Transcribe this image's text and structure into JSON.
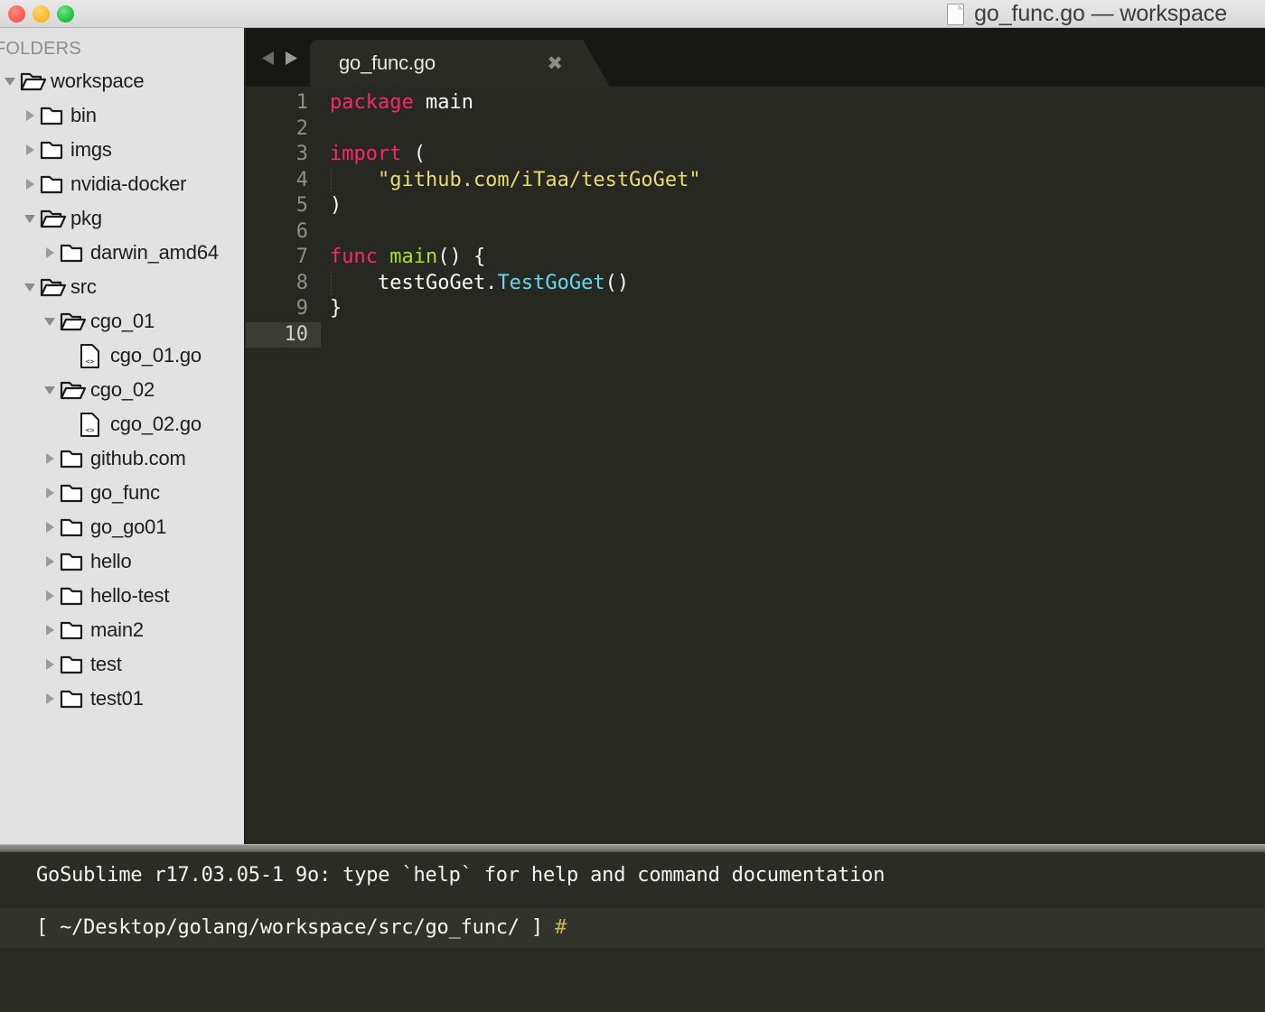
{
  "window": {
    "title": "go_func.go — workspace",
    "doc_icon": "document-icon",
    "traffic_lights": [
      {
        "name": "close-button",
        "color": "#ff5f57"
      },
      {
        "name": "minimize-button",
        "color": "#ffbd2e"
      },
      {
        "name": "maximize-button",
        "color": "#28c840"
      }
    ]
  },
  "sidebar": {
    "header": "FOLDERS",
    "items": [
      {
        "label": "workspace",
        "depth": 0,
        "type": "folder-open",
        "arrow": "down",
        "icon": "folder-open-icon"
      },
      {
        "label": "bin",
        "depth": 1,
        "type": "folder-closed",
        "arrow": "right",
        "icon": "folder-icon"
      },
      {
        "label": "imgs",
        "depth": 1,
        "type": "folder-closed",
        "arrow": "right",
        "icon": "folder-icon"
      },
      {
        "label": "nvidia-docker",
        "depth": 1,
        "type": "folder-closed",
        "arrow": "right",
        "icon": "folder-icon"
      },
      {
        "label": "pkg",
        "depth": 1,
        "type": "folder-open",
        "arrow": "down",
        "icon": "folder-open-icon"
      },
      {
        "label": "darwin_amd64",
        "depth": 2,
        "type": "folder-closed",
        "arrow": "right",
        "icon": "folder-icon"
      },
      {
        "label": "src",
        "depth": 1,
        "type": "folder-open",
        "arrow": "down",
        "icon": "folder-open-icon"
      },
      {
        "label": "cgo_01",
        "depth": 2,
        "type": "folder-open",
        "arrow": "down",
        "icon": "folder-open-icon"
      },
      {
        "label": "cgo_01.go",
        "depth": 3,
        "type": "file",
        "arrow": "none",
        "icon": "code-file-icon"
      },
      {
        "label": "cgo_02",
        "depth": 2,
        "type": "folder-open",
        "arrow": "down",
        "icon": "folder-open-icon"
      },
      {
        "label": "cgo_02.go",
        "depth": 3,
        "type": "file",
        "arrow": "none",
        "icon": "code-file-icon"
      },
      {
        "label": "github.com",
        "depth": 2,
        "type": "folder-closed",
        "arrow": "right",
        "icon": "folder-icon"
      },
      {
        "label": "go_func",
        "depth": 2,
        "type": "folder-closed",
        "arrow": "right",
        "icon": "folder-icon"
      },
      {
        "label": "go_go01",
        "depth": 2,
        "type": "folder-closed",
        "arrow": "right",
        "icon": "folder-icon"
      },
      {
        "label": "hello",
        "depth": 2,
        "type": "folder-closed",
        "arrow": "right",
        "icon": "folder-icon"
      },
      {
        "label": "hello-test",
        "depth": 2,
        "type": "folder-closed",
        "arrow": "right",
        "icon": "folder-icon"
      },
      {
        "label": "main2",
        "depth": 2,
        "type": "folder-closed",
        "arrow": "right",
        "icon": "folder-icon"
      },
      {
        "label": "test",
        "depth": 2,
        "type": "folder-closed",
        "arrow": "right",
        "icon": "folder-icon"
      },
      {
        "label": "test01",
        "depth": 2,
        "type": "folder-closed",
        "arrow": "right",
        "icon": "folder-icon"
      }
    ]
  },
  "tabbar": {
    "prev_icon": "arrow-left-icon",
    "next_icon": "arrow-right-icon",
    "tabs": [
      {
        "label": "go_func.go",
        "close_glyph": "✖",
        "active": true
      }
    ]
  },
  "editor": {
    "language": "go",
    "active_line": 10,
    "line_numbers": [
      "1",
      "2",
      "3",
      "4",
      "5",
      "6",
      "7",
      "8",
      "9",
      "10"
    ],
    "lines": [
      {
        "n": 1,
        "indented": false,
        "tokens": [
          {
            "t": "package",
            "c": "kw"
          },
          {
            "t": " main",
            "c": "pl"
          }
        ]
      },
      {
        "n": 2,
        "indented": false,
        "tokens": []
      },
      {
        "n": 3,
        "indented": false,
        "tokens": [
          {
            "t": "import",
            "c": "kw"
          },
          {
            "t": " (",
            "c": "pl"
          }
        ]
      },
      {
        "n": 4,
        "indented": true,
        "tokens": [
          {
            "t": "    \"github.com/iTaa/testGoGet\"",
            "c": "str"
          }
        ]
      },
      {
        "n": 5,
        "indented": false,
        "tokens": [
          {
            "t": ")",
            "c": "pl"
          }
        ]
      },
      {
        "n": 6,
        "indented": false,
        "tokens": []
      },
      {
        "n": 7,
        "indented": false,
        "tokens": [
          {
            "t": "func",
            "c": "kw"
          },
          {
            "t": " ",
            "c": "pl"
          },
          {
            "t": "main",
            "c": "fn"
          },
          {
            "t": "() {",
            "c": "pl"
          }
        ]
      },
      {
        "n": 8,
        "indented": true,
        "tokens": [
          {
            "t": "    testGoGet.",
            "c": "pl"
          },
          {
            "t": "TestGoGet",
            "c": "type"
          },
          {
            "t": "()",
            "c": "pl"
          }
        ]
      },
      {
        "n": 9,
        "indented": false,
        "tokens": [
          {
            "t": "}",
            "c": "pl"
          }
        ]
      },
      {
        "n": 10,
        "indented": false,
        "tokens": []
      }
    ],
    "raw_text": "package main\n\nimport (\n    \"github.com/iTaa/testGoGet\"\n)\n\nfunc main() {\n    testGoGet.TestGoGet()\n}\n",
    "colors": {
      "background": "#272822",
      "keyword": "#f92672",
      "function": "#a6e22e",
      "string": "#e6db74",
      "type": "#66d9ef",
      "plain": "#f8f8f2",
      "gutter_text": "#8f8f85",
      "active_line": "#3b3c35"
    }
  },
  "console": {
    "message": "GoSublime r17.03.05-1 9o: type `help` for help and command documentation",
    "prompt_path": "[ ~/Desktop/golang/workspace/src/go_func/ ]",
    "prompt_symbol": "#",
    "prompt_symbol_color": "#c8b560"
  }
}
